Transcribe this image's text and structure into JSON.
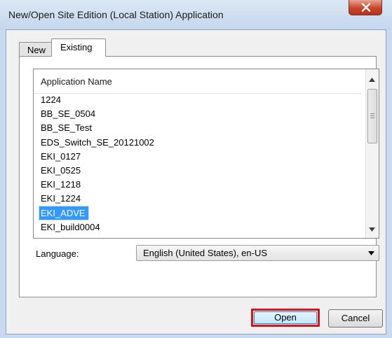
{
  "window": {
    "title": "New/Open Site Edition (Local Station) Application"
  },
  "tabs": [
    {
      "label": "New"
    },
    {
      "label": "Existing"
    }
  ],
  "list": {
    "header": "Application Name",
    "items": [
      "1224",
      "BB_SE_0504",
      "BB_SE_Test",
      "EDS_Switch_SE_20121002",
      "EKI_0127",
      "EKI_0525",
      "EKI_1218",
      "EKI_1224",
      "EKI_ADVE",
      "EKI_build0004"
    ],
    "selected_index": 8
  },
  "language": {
    "label": "Language:",
    "value": "English (United States), en-US"
  },
  "buttons": {
    "open": "Open",
    "cancel": "Cancel"
  },
  "colors": {
    "selection": "#3399ff",
    "highlight_border": "#d9121b",
    "close_button": "#c8452c"
  }
}
